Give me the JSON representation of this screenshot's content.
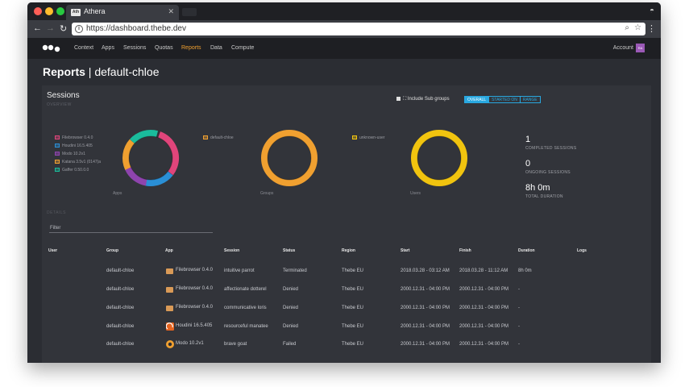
{
  "browser": {
    "tab_title": "Athera",
    "tab_favicon_text": "Ath",
    "url": "https://dashboard.thebe.dev"
  },
  "nav": {
    "items": [
      "Context",
      "Apps",
      "Sessions",
      "Quotas",
      "Reports",
      "Data",
      "Compute"
    ],
    "active": "Reports",
    "account_label": "Account",
    "avatar_text": "RA"
  },
  "page": {
    "title_bold": "Reports",
    "title_sep": " | ",
    "title_rest": "default-chloe"
  },
  "sessions": {
    "title": "Sessions",
    "overview_label": "OVERVIEW",
    "include_subgroups": "Include Sub groups",
    "range_buttons": [
      "OVERALL",
      "STARTED ON",
      "RANGE"
    ],
    "range_active": "OVERALL",
    "apps_legend": [
      {
        "name": "Filebrowser 0.4.0",
        "color": "#e0457b"
      },
      {
        "name": "Houdini 16.5.405",
        "color": "#2a8fd6"
      },
      {
        "name": "Modo 10.2v1",
        "color": "#8e44ad"
      },
      {
        "name": "Katana 3.5v1 (0147)a",
        "color": "#f0a030"
      },
      {
        "name": "Gaffer 0.50.0.0",
        "color": "#1abc9c"
      }
    ],
    "groups_legend": [
      {
        "name": "default-chloe",
        "color": "#f0a030"
      }
    ],
    "users_legend": [
      {
        "name": "unknown-user",
        "color": "#f1c40f"
      }
    ],
    "captions": {
      "apps": "Apps",
      "groups": "Groups",
      "users": "Users"
    },
    "stats": [
      {
        "value": "1",
        "label": "COMPLETED SESSIONS"
      },
      {
        "value": "0",
        "label": "ONGOING SESSIONS"
      },
      {
        "value": "8h 0m",
        "label": "TOTAL DURATION"
      }
    ],
    "details_label": "DETAILS",
    "filter_placeholder": "Filter"
  },
  "table": {
    "headers": [
      "User",
      "Group",
      "App",
      "Session",
      "Status",
      "Region",
      "Start",
      "Finish",
      "Duration",
      "Logs"
    ],
    "rows": [
      {
        "user": "",
        "group": "default-chloe",
        "app": "Filebrowser 0.4.0",
        "app_icon": "folder-icon",
        "session": "intuitive parrot",
        "status": "Terminated",
        "region": "Thebe EU",
        "start": "2018.03.28 - 03:12 AM",
        "finish": "2018.03.28 - 11:12 AM",
        "duration": "8h 0m",
        "logs": ""
      },
      {
        "user": "",
        "group": "default-chloe",
        "app": "Filebrowser 0.4.0",
        "app_icon": "folder-icon",
        "session": "affectionate dotterel",
        "status": "Denied",
        "region": "Thebe EU",
        "start": "2000.12.31 - 04:00 PM",
        "finish": "2000.12.31 - 04:00 PM",
        "duration": "-",
        "logs": ""
      },
      {
        "user": "",
        "group": "default-chloe",
        "app": "Filebrowser 0.4.0",
        "app_icon": "folder-icon",
        "session": "communicative loris",
        "status": "Denied",
        "region": "Thebe EU",
        "start": "2000.12.31 - 04:00 PM",
        "finish": "2000.12.31 - 04:00 PM",
        "duration": "-",
        "logs": ""
      },
      {
        "user": "",
        "group": "default-chloe",
        "app": "Houdini 16.5.405",
        "app_icon": "houdini-icon",
        "session": "resourceful manatee",
        "status": "Denied",
        "region": "Thebe EU",
        "start": "2000.12.31 - 04:00 PM",
        "finish": "2000.12.31 - 04:00 PM",
        "duration": "-",
        "logs": ""
      },
      {
        "user": "",
        "group": "default-chloe",
        "app": "Modo 10.2v1",
        "app_icon": "modo-icon",
        "session": "brave goat",
        "status": "Failed",
        "region": "Thebe EU",
        "start": "2000.12.31 - 04:00 PM",
        "finish": "2000.12.31 - 04:00 PM",
        "duration": "-",
        "logs": ""
      }
    ]
  }
}
